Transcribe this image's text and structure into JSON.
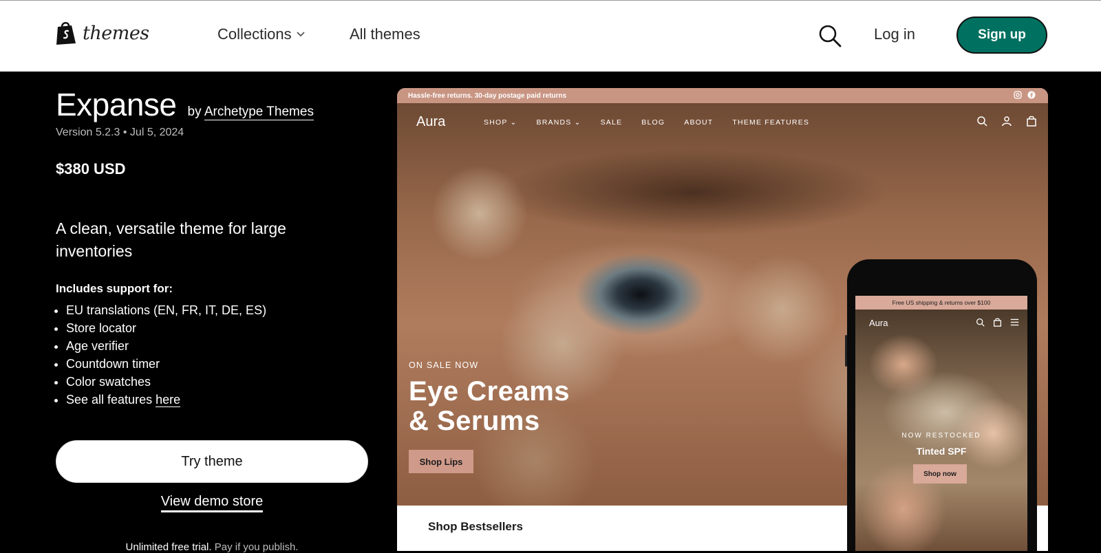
{
  "header": {
    "brand": "themes",
    "nav": [
      {
        "label": "Collections"
      },
      {
        "label": "All themes"
      }
    ],
    "login": "Log in",
    "signup": "Sign up"
  },
  "theme": {
    "title": "Expanse",
    "by_prefix": "by",
    "author": "Archetype Themes",
    "version": "Version 5.2.3",
    "bullet": "•",
    "date": "Jul 5, 2024",
    "price": "$380 USD",
    "tagline": "A clean, versatile theme for large inventories",
    "support_heading": "Includes support for:",
    "features": [
      "EU translations (EN, FR, IT, DE, ES)",
      "Store locator",
      "Age verifier",
      "Countdown timer",
      "Color swatches"
    ],
    "features_more_prefix": "See all features",
    "features_more_link": "here",
    "try_button": "Try theme",
    "demo_link": "View demo store",
    "trial_text": "Unlimited free trial.",
    "trial_muted": "Pay if you publish."
  },
  "preview": {
    "announcement": "Hassle-free returns. 30-day postage paid returns",
    "store_brand": "Aura",
    "menu": [
      "SHOP",
      "BRANDS",
      "SALE",
      "BLOG",
      "ABOUT",
      "THEME FEATURES"
    ],
    "on_sale": "ON SALE NOW",
    "headline_1": "Eye Creams",
    "headline_2": "& Serums",
    "cta": "Shop Lips",
    "section_title": "Shop Bestsellers",
    "mobile": {
      "announcement": "Free US shipping & returns over $100",
      "store_brand": "Aura",
      "eyebrow": "NOW RESTOCKED",
      "headline": "Tinted SPF",
      "cta": "Shop now"
    }
  },
  "colors": {
    "signup_bg": "#007060",
    "page_bg": "#000000",
    "announce_bg": "#c99583",
    "cta_bg": "#d09a8a"
  }
}
